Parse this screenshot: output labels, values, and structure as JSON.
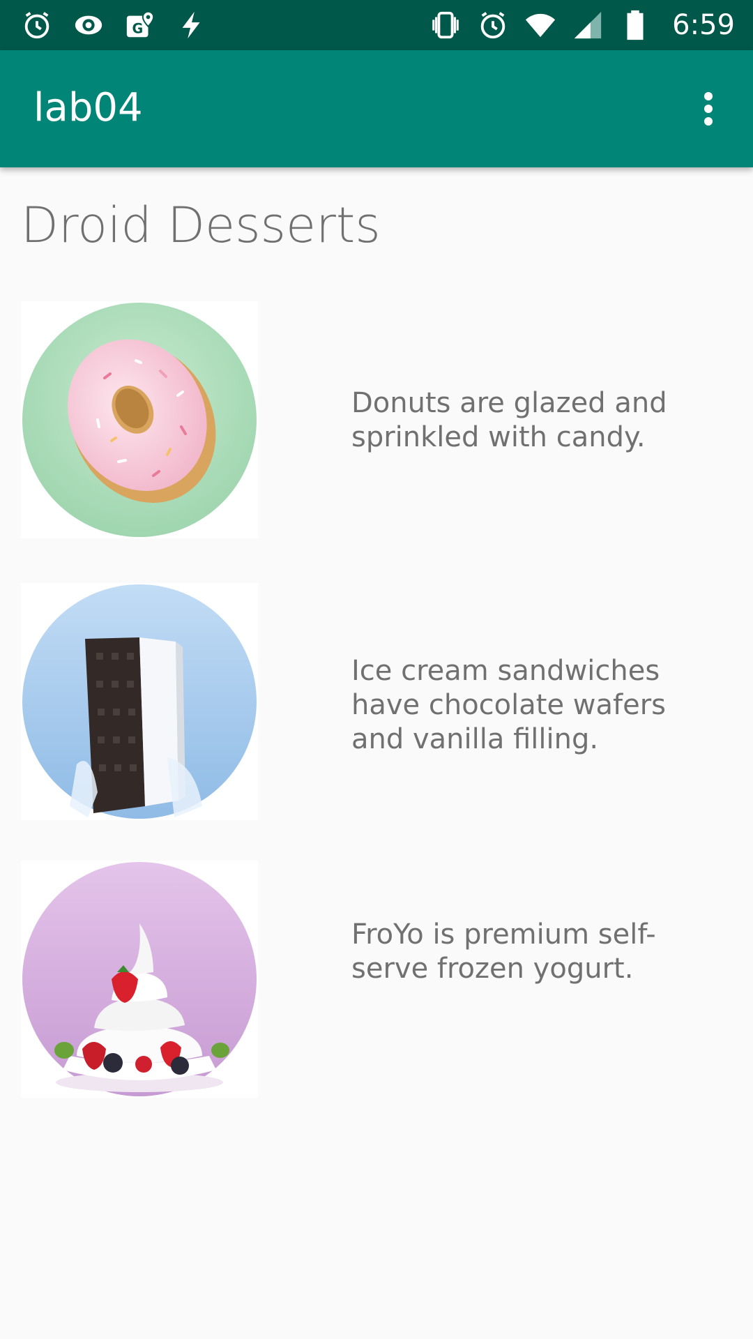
{
  "status_bar": {
    "time": "6:59",
    "left_icons": [
      "alarm-icon",
      "eye-icon",
      "maps-icon",
      "flash-icon"
    ],
    "right_icons": [
      "vibrate-icon",
      "alarm-icon",
      "wifi-icon",
      "signal-icon",
      "battery-icon"
    ]
  },
  "app_bar": {
    "title": "lab04",
    "menu_icon": "more-vert-icon"
  },
  "page": {
    "heading": "Droid Desserts"
  },
  "desserts": [
    {
      "image_icon": "donut-image",
      "description": "Donuts are glazed and sprinkled with candy."
    },
    {
      "image_icon": "ice-cream-sandwich-image",
      "description": "Ice cream sandwiches have chocolate wafers and vanilla filling."
    },
    {
      "image_icon": "froyo-image",
      "description": "FroYo is premium self-serve frozen yogurt."
    }
  ],
  "colors": {
    "status_bar": "#00584a",
    "app_bar": "#018577",
    "background": "#fafafa",
    "text": "#707070"
  }
}
